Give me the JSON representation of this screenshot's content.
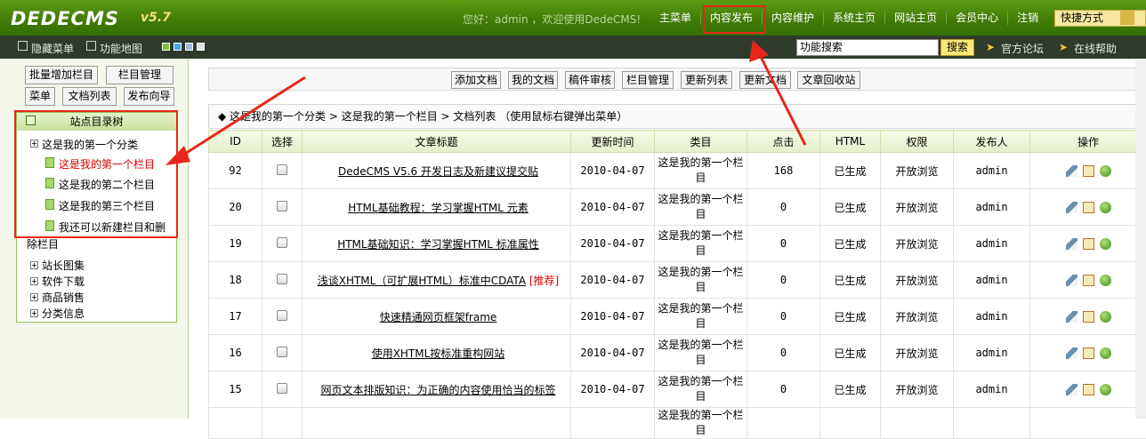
{
  "header": {
    "logo": "DEDECMS",
    "version": "v5.7",
    "greeting": "您好：admin ，欢迎使用DedeCMS!",
    "nav": [
      "主菜单",
      "内容发布",
      "内容维护",
      "系统主页",
      "网站主页",
      "会员中心",
      "注销"
    ],
    "quick_label": "快捷方式"
  },
  "subbar": {
    "hide_menu": "隐藏菜单",
    "func_map": "功能地图",
    "search_value": "功能搜索",
    "search_button": "搜索",
    "forum": "官方论坛",
    "help": "在线帮助"
  },
  "left": {
    "buttons": [
      "批量增加栏目",
      "栏目管理",
      "菜单",
      "文档列表",
      "发布向导"
    ],
    "tree_title": "站点目录树",
    "tree": [
      {
        "label": "这是我的第一个分类",
        "type": "folder"
      },
      {
        "label": "这是我的第一个栏目",
        "type": "doc",
        "active": true
      },
      {
        "label": "这是我的第二个栏目",
        "type": "doc"
      },
      {
        "label": "这是我的第三个栏目",
        "type": "doc"
      },
      {
        "label": "我还可以新建栏目和删",
        "type": "doc"
      }
    ],
    "tree_tail": "除栏目",
    "tree2": [
      "站长图集",
      "软件下载",
      "商品销售",
      "分类信息"
    ]
  },
  "toolbar": [
    "添加文档",
    "我的文档",
    "稿件审核",
    "栏目管理",
    "更新列表",
    "更新文档",
    "文章回收站"
  ],
  "breadcrumb": "◆  这是我的第一个分类 > 这是我的第一个栏目 > 文档列表   （使用鼠标右键弹出菜单）",
  "table": {
    "headers": [
      "ID",
      "选择",
      "文章标题",
      "更新时间",
      "类目",
      "点击",
      "HTML",
      "权限",
      "发布人",
      "操作"
    ],
    "rows": [
      {
        "id": "92",
        "title": "DedeCMS V5.6 开发日志及新建议提交贴",
        "rec": "",
        "date": "2010-04-07",
        "cat": "这是我的第一个栏目",
        "clicks": "168",
        "html": "已生成",
        "perm": "开放浏览",
        "author": "admin"
      },
      {
        "id": "20",
        "title": "HTML基础教程：学习掌握HTML 元素",
        "rec": "",
        "date": "2010-04-07",
        "cat": "这是我的第一个栏目",
        "clicks": "0",
        "html": "已生成",
        "perm": "开放浏览",
        "author": "admin"
      },
      {
        "id": "19",
        "title": "HTML基础知识：学习掌握HTML 标准属性",
        "rec": "",
        "date": "2010-04-07",
        "cat": "这是我的第一个栏目",
        "clicks": "0",
        "html": "已生成",
        "perm": "开放浏览",
        "author": "admin"
      },
      {
        "id": "18",
        "title": "浅谈XHTML（可扩展HTML）标准中CDATA",
        "rec": "[推荐]",
        "date": "2010-04-07",
        "cat": "这是我的第一个栏目",
        "clicks": "0",
        "html": "已生成",
        "perm": "开放浏览",
        "author": "admin"
      },
      {
        "id": "17",
        "title": "快速精通网页框架frame",
        "rec": "",
        "date": "2010-04-07",
        "cat": "这是我的第一个栏目",
        "clicks": "0",
        "html": "已生成",
        "perm": "开放浏览",
        "author": "admin"
      },
      {
        "id": "16",
        "title": "使用XHTML按标准重构网站",
        "rec": "",
        "date": "2010-04-07",
        "cat": "这是我的第一个栏目",
        "clicks": "0",
        "html": "已生成",
        "perm": "开放浏览",
        "author": "admin"
      },
      {
        "id": "15",
        "title": "网页文本排版知识：为正确的内容使用恰当的标签",
        "rec": "",
        "date": "2010-04-07",
        "cat": "这是我的第一个栏目",
        "clicks": "0",
        "html": "已生成",
        "perm": "开放浏览",
        "author": "admin"
      },
      {
        "id": "",
        "title": "",
        "rec": "",
        "date": "",
        "cat": "这是我的第一个栏目",
        "clicks": "",
        "html": "",
        "perm": "",
        "author": ""
      }
    ]
  },
  "colors": {
    "topbar": "#3f7a06",
    "highlight": "#e8261b",
    "active_item": "#d40000"
  }
}
